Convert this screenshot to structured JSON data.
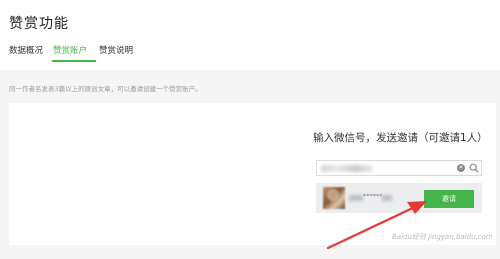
{
  "page": {
    "title": "赞赏功能"
  },
  "tabs": [
    {
      "label": "数据概况",
      "active": false
    },
    {
      "label": "赞赏账户",
      "active": true
    },
    {
      "label": "赞赏说明",
      "active": false
    }
  ],
  "notice": "同一作者名发表3篇以上的原创文章，可以邀请创建一个赞赏账户。",
  "invite": {
    "title": "输入微信号，发送邀请（可邀请1人）",
    "search_value": "",
    "result": {
      "account_id_masked": "******",
      "button_label": "邀请"
    }
  },
  "watermark": "Baidu经验 jingyan.baidu.com",
  "colors": {
    "accent": "#44b549",
    "background": "#f5f5f5",
    "arrow": "#e8382f"
  },
  "icons": [
    "clear-icon",
    "search-icon",
    "arrow-icon"
  ]
}
